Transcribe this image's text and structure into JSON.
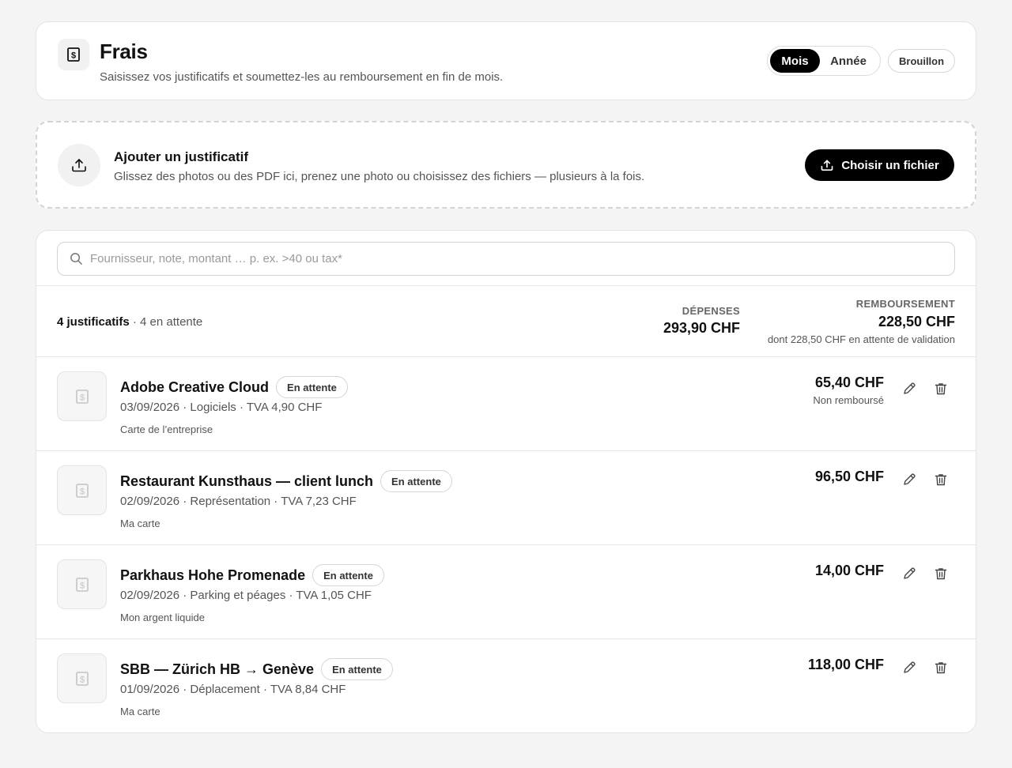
{
  "header": {
    "title": "Frais",
    "subtitle": "Saisissez vos justificatifs et soumettez-les au remboursement en fin de mois.",
    "period_toggle": {
      "options": [
        "Mois",
        "Année"
      ],
      "selected": "Mois"
    },
    "draft_badge": "Brouillon"
  },
  "upload": {
    "title": "Ajouter un justificatif",
    "description": "Glissez des photos ou des PDF ici, prenez une photo ou choisissez des fichiers — plusieurs à la fois.",
    "button_label": "Choisir un fichier"
  },
  "search": {
    "placeholder": "Fournisseur, note, montant … p. ex. >40 ou tax*",
    "value": ""
  },
  "summary": {
    "count_label": "4 justificatifs",
    "pending_label": "· 4 en attente",
    "expenses_label": "DÉPENSES",
    "expenses_value": "293,90 CHF",
    "reimbursement_label": "REMBOURSEMENT",
    "reimbursement_value": "228,50 CHF",
    "reimbursement_note": "dont 228,50 CHF en attente de validation"
  },
  "receipts": [
    {
      "vendor": "Adobe Creative Cloud",
      "status": "En attente",
      "meta": "03/09/2026 · Logiciels · TVA 4,90 CHF",
      "source": "Carte de l’entreprise",
      "amount": "65,40 CHF",
      "note": "Non remboursé"
    },
    {
      "vendor": "Restaurant Kunsthaus — client lunch",
      "status": "En attente",
      "meta": "02/09/2026 · Représentation · TVA 7,23 CHF",
      "source": "Ma carte",
      "amount": "96,50 CHF",
      "note": ""
    },
    {
      "vendor": "Parkhaus Hohe Promenade",
      "status": "En attente",
      "meta": "02/09/2026 · Parking et péages · TVA 1,05 CHF",
      "source": "Mon argent liquide",
      "amount": "14,00 CHF",
      "note": ""
    },
    {
      "vendor": "SBB — Zürich HB → Genève",
      "status": "En attente",
      "meta": "01/09/2026 · Déplacement · TVA 8,84 CHF",
      "source": "Ma carte",
      "amount": "118,00 CHF",
      "note": ""
    }
  ],
  "icons": {
    "app": "receipt-dollar-icon",
    "upload": "upload-icon",
    "search": "search-icon",
    "thumb": "receipt-placeholder-icon",
    "edit": "pencil-icon",
    "delete": "trash-icon"
  },
  "colors": {
    "accent": "#000000",
    "background": "#f4f4f4",
    "muted": "#555555"
  }
}
